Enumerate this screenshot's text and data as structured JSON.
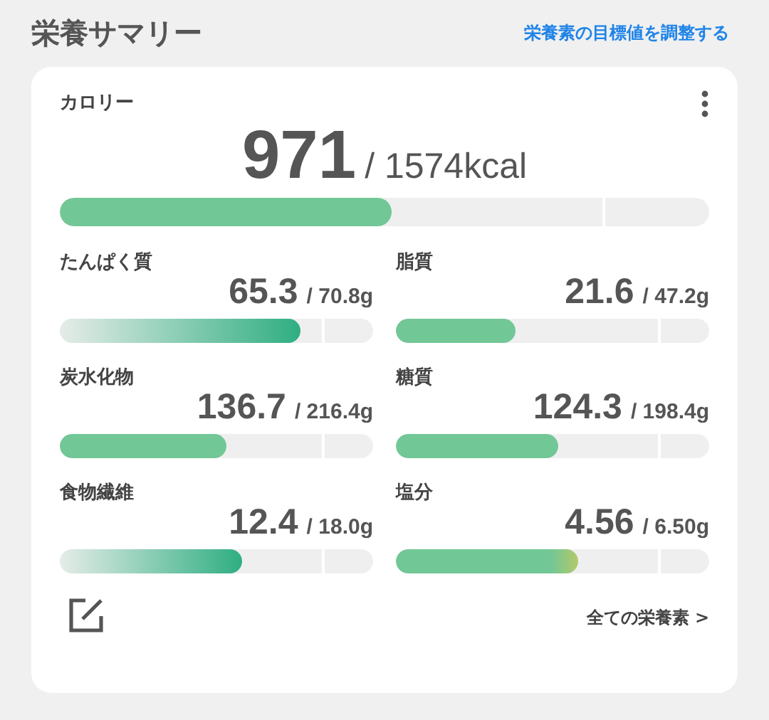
{
  "header": {
    "title": "栄養サマリー",
    "link": "栄養素の目標値を調整する"
  },
  "calorie": {
    "label": "カロリー",
    "value": "971",
    "target": "/ 1574kcal",
    "level": 0.51
  },
  "nutrients": [
    {
      "label": "たんぱく質",
      "value": "65.3",
      "target": "/ 70.8g",
      "level": 0.77,
      "kind": "gradient"
    },
    {
      "label": "脂質",
      "value": "21.6",
      "target": "/ 47.2g",
      "level": 0.38,
      "kind": "solid"
    },
    {
      "label": "炭水化物",
      "value": "136.7",
      "target": "/ 216.4g",
      "level": 0.53,
      "kind": "solid"
    },
    {
      "label": "糖質",
      "value": "124.3",
      "target": "/ 198.4g",
      "level": 0.52,
      "kind": "solid"
    },
    {
      "label": "食物繊維",
      "value": "12.4",
      "target": "/ 18.0g",
      "level": 0.58,
      "kind": "gradient"
    },
    {
      "label": "塩分",
      "value": "4.56",
      "target": "/ 6.50g",
      "level": 0.58,
      "kind": "warning"
    }
  ],
  "footer": {
    "link": "全ての栄養素 >"
  }
}
